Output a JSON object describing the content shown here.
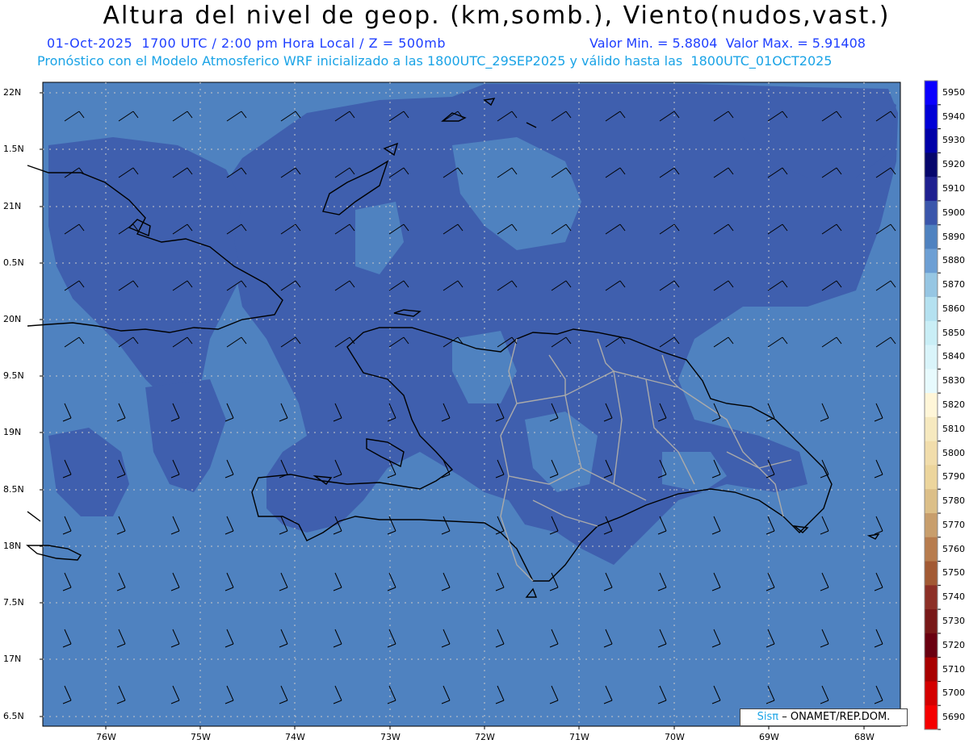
{
  "header": {
    "title": "Altura del nivel de geop. (km,somb.), Viento(nudos,vast.)",
    "line1": "01-Oct-2025  1700 UTC / 2:00 pm Hora Local / Z = 500mb",
    "line1_right": "Valor Min. = 5.8804  Valor Max. = 5.91408",
    "line2": "Pronóstico con el Modelo Atmosferico WRF inicializado a las 1800UTC_29SEP2025 y válido hasta las  1800UTC_01OCT2025"
  },
  "map": {
    "lat_labels": [
      "22N",
      "1.5N",
      "21N",
      "0.5N",
      "20N",
      "9.5N",
      "19N",
      "8.5N",
      "18N",
      "7.5N",
      "17N",
      "6.5N"
    ],
    "lon_labels": [
      "76W",
      "75W",
      "74W",
      "73W",
      "72W",
      "71W",
      "70W",
      "69W",
      "68W"
    ],
    "colors": {
      "sea_level": "#4f82c0",
      "land_level": "#3f5fae",
      "border": "#aaaaaa",
      "coast": "#000000"
    }
  },
  "colorbar": {
    "labels": [
      "5950",
      "5940",
      "5930",
      "5920",
      "5910",
      "5900",
      "5890",
      "5880",
      "5870",
      "5860",
      "5850",
      "5840",
      "5830",
      "5820",
      "5810",
      "5800",
      "5790",
      "5780",
      "5770",
      "5760",
      "5750",
      "5740",
      "5730",
      "5720",
      "5710",
      "5700",
      "5690"
    ],
    "colors": [
      "#0a00ff",
      "#0000d6",
      "#0000a8",
      "#06066c",
      "#1f2090",
      "#3a56ab",
      "#4f82c0",
      "#6d9fd4",
      "#96c6e3",
      "#b4e1f0",
      "#c9eef6",
      "#d9f4fa",
      "#e7fafd",
      "#fff6d8",
      "#f6e9bf",
      "#f1ddab",
      "#ecd59c",
      "#dcbf88",
      "#c89e6c",
      "#b77c4e",
      "#a25a34",
      "#8c2f26",
      "#781818",
      "#6a0010",
      "#a80000",
      "#d40000",
      "#f50000"
    ]
  },
  "credit": {
    "brand": "Sisπ",
    "text": "– ONAMET/REP.DOM."
  }
}
